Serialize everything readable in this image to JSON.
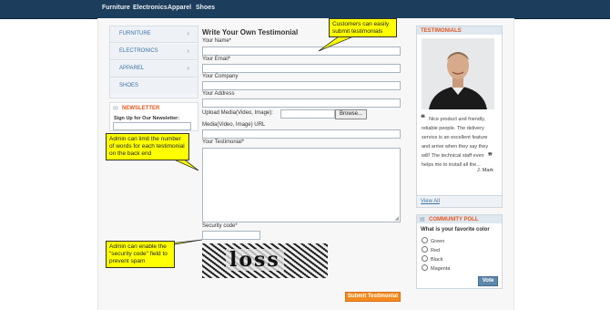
{
  "topnav": {
    "items": [
      "Furniture",
      "Electronics",
      "Apparel",
      "Shoes"
    ]
  },
  "sidebar": {
    "categories": [
      "FURNITURE",
      "ELECTRONICS",
      "APPAREL",
      "SHOES"
    ],
    "newsletter_title": "NEWSLETTER",
    "newsletter_label": "Sign Up for Our Newsletter:"
  },
  "form": {
    "title": "Write Your Own Testimonial",
    "name_label": "Your Name*",
    "email_label": "Your Email*",
    "company_label": "Your Company",
    "address_label": "Your Address",
    "upload_label": "Upload Media(Video, Image):",
    "browse_label": "Browse...",
    "media_url_label": "Media(Video, Image) URL",
    "testimonial_label": "Your Testimonial*",
    "security_label": "Security code*",
    "captcha_text": "loss",
    "submit_label": "Submit Testimonial"
  },
  "callouts": {
    "submit": "Customers can easily submit testimonials",
    "words": "Admin can limit the number of words for each testimonial on the back end",
    "security": "Admin can enable the \"security code\" field to prevent spam"
  },
  "testimonials": {
    "title": "TESTIMONIALS",
    "quote": "Nice product and friendly, reliable people. The delivery service is an excellent feature and arrive when they say they will! The technical staff even helps me to install all the...",
    "author": "J. Mark",
    "view_all": "View All"
  },
  "poll": {
    "title": "COMMUNITY POLL",
    "question": "What is your favorite color",
    "options": [
      "Green",
      "Red",
      "Black",
      "Magenta"
    ],
    "vote_label": "Vote"
  },
  "colors": {
    "accent": "#e4571f",
    "nav": "#1d3d5c",
    "callout": "#ffff00",
    "button": "#f38a1f"
  }
}
